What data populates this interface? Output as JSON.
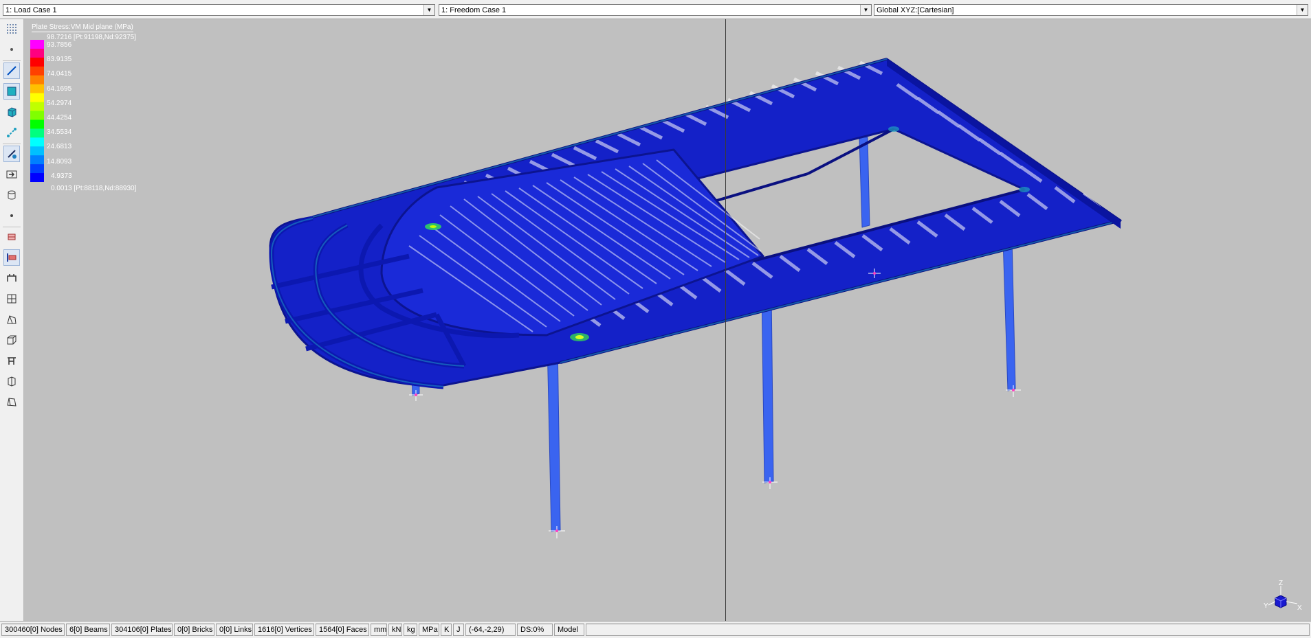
{
  "toolbar_top": {
    "load_case": "1: Load Case 1",
    "freedom_case": "1: Freedom Case 1",
    "coord_system": "Global XYZ:[Cartesian]"
  },
  "legend": {
    "title": "Plate Stress:VM Mid plane (MPa)",
    "max_label": "98.7216 [Pt:91198,Nd:92375]",
    "min_label": "0.0013 [Pt:88118,Nd:88930]",
    "ticks": [
      "93.7856",
      "83.9135",
      "74.0415",
      "64.1695",
      "54.2974",
      "44.4254",
      "34.5534",
      "24.6813",
      "14.8093",
      "4.9373"
    ],
    "colors": [
      "#ff00ff",
      "#ff0080",
      "#ff0000",
      "#ff4000",
      "#ff8000",
      "#ffc000",
      "#ffff00",
      "#c0ff00",
      "#80ff00",
      "#00ff00",
      "#00ff80",
      "#00ffff",
      "#00c0ff",
      "#0080ff",
      "#0040ff",
      "#0000ff"
    ]
  },
  "status": {
    "nodes": "300460[0] Nodes",
    "beams": "6[0] Beams",
    "plates": "304106[0] Plates",
    "bricks": "0[0] Bricks",
    "links": "0[0] Links",
    "vertices": "1616[0] Vertices",
    "faces": "1564[0] Faces",
    "unit_length": "mm",
    "unit_force": "kN",
    "unit_mass": "kg",
    "unit_stress": "MPa",
    "unit_temp": "K",
    "unit_energy": "J",
    "coords": "(-64,-2,29)",
    "ds": "DS:0%",
    "mode": "Model"
  },
  "axis": {
    "x": "X",
    "y": "Y",
    "z": "Z"
  },
  "colors": {
    "viewport_bg": "#c0c0c0",
    "mesh_blue": "#1a2ad8",
    "column_blue": "#3a64f0"
  }
}
